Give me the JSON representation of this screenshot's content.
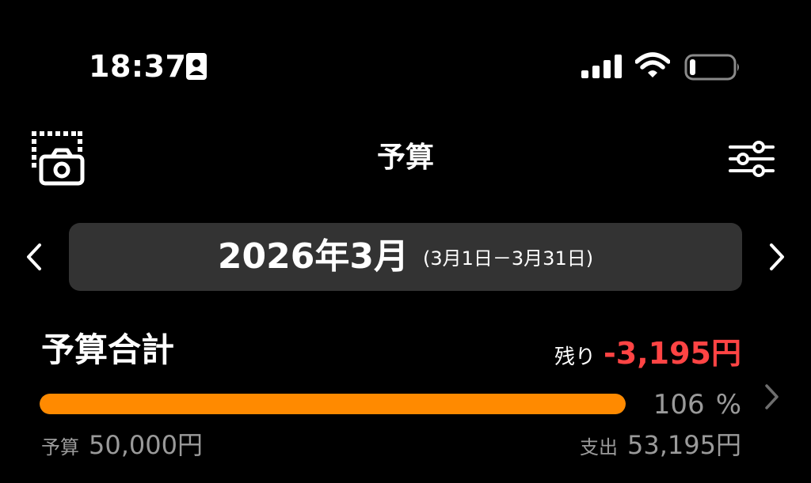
{
  "status_bar": {
    "time": "18:37",
    "signal": "signal-icon",
    "wifi": "wifi-icon",
    "battery": "battery-low-icon"
  },
  "header": {
    "title": "予算",
    "left_icon": "camera-capture-icon",
    "right_icon": "sliders-icon"
  },
  "period": {
    "label": "2026年3月",
    "range": "(3月1日－3月31日)"
  },
  "summary": {
    "title": "予算合計",
    "remaining_label": "残り",
    "remaining_value": "-3,195円",
    "percent": "106",
    "percent_unit": "%",
    "progress_fraction": 1.0,
    "budget_label": "予算",
    "budget_value": "50,000円",
    "spent_label": "支出",
    "spent_value": "53,195円"
  },
  "colors": {
    "background": "#000000",
    "pill": "#333333",
    "progress": "#ff8a00",
    "negative": "#ff4444",
    "muted": "#9a9a9a"
  }
}
